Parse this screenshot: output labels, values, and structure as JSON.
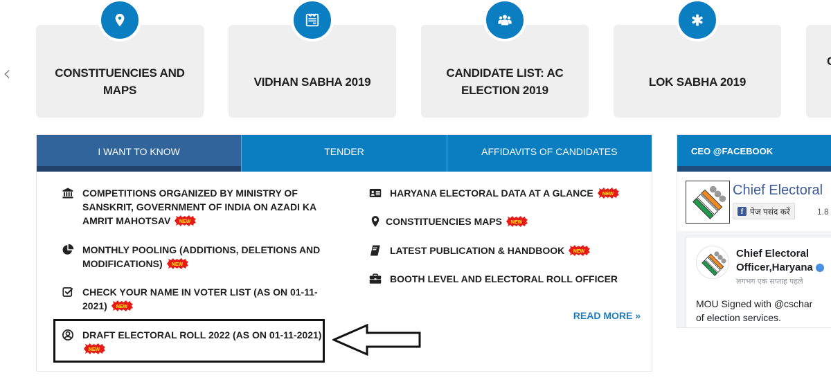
{
  "carousel": {
    "prev_label": "‹",
    "cards": [
      {
        "title": "CONSTITUENCIES AND MAPS",
        "icon": "map-marker-icon"
      },
      {
        "title": "VIDHAN SABHA 2019",
        "icon": "newspaper-icon"
      },
      {
        "title": "CANDIDATE LIST: AC ELECTION 2019",
        "icon": "users-icon"
      },
      {
        "title": "LOK SABHA 2019",
        "icon": "asterisk-icon"
      },
      {
        "title": "C",
        "icon": ""
      }
    ]
  },
  "tabs": [
    {
      "label": "I WANT TO KNOW",
      "active": true
    },
    {
      "label": "TENDER",
      "active": false
    },
    {
      "label": "AFFIDAVITS OF CANDIDATES",
      "active": false
    }
  ],
  "left_items": [
    {
      "line1": "COMPETITIONS ORGANIZED BY MINISTRY OF",
      "line2": "SANSKRIT, GOVERNMENT OF INDIA ON AZADI KA",
      "line3": "AMRIT MAHOTSAV",
      "icon": "bank-icon",
      "new": true
    },
    {
      "line1": "MONTHLY POOLING (ADDITIONS, DELETIONS AND",
      "line2": "MODIFICATIONS)",
      "icon": "pie-chart-icon",
      "new": true
    },
    {
      "line1": "CHECK YOUR NAME IN VOTER LIST (AS ON 01-11-",
      "line2": "2021)",
      "icon": "checkbox-icon",
      "new": true
    },
    {
      "line1": "DRAFT ELECTORAL ROLL 2022 (AS ON 01-11-2021)",
      "line2": "",
      "icon": "user-circle-icon",
      "new": true
    }
  ],
  "right_items": [
    {
      "text": "HARYANA ELECTORAL DATA AT A GLANCE",
      "icon": "id-card-icon",
      "new": true
    },
    {
      "text": "CONSTITUENCIES MAPS",
      "icon": "map-marker-icon",
      "new": true
    },
    {
      "text": "LATEST PUBLICATION & HANDBOOK",
      "icon": "book-icon",
      "new": true
    },
    {
      "text": "BOOTH LEVEL AND ELECTORAL ROLL OFFICER",
      "icon": "briefcase-icon",
      "new": false
    }
  ],
  "new_badge_label": "NEW",
  "read_more": "READ MORE »",
  "facebook": {
    "header": "CEO @FACEBOOK",
    "page_name": "Chief Electoral",
    "like_label": "पेज पसंद करें",
    "like_count": "1.8",
    "post": {
      "author_line1": "Chief Electoral",
      "author_line2": "Officer,Haryana",
      "time": "लगभग एक सप्ताह पहले",
      "text_line1": "MOU Signed with @cschar",
      "text_line2": "of election services."
    }
  },
  "colors": {
    "primary": "#0b7dc1",
    "active_tab": "#30649b",
    "active_tab_bar": "#23426b",
    "card_bg": "#efefef",
    "link": "#1a7bbd",
    "facebook": "#3b5998"
  }
}
